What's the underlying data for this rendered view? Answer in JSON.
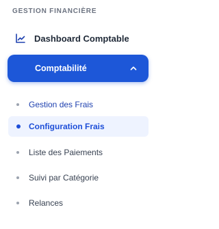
{
  "sidebar": {
    "section_title": "GESTION FINANCIÈRE",
    "dashboard": {
      "label": "Dashboard Comptable",
      "icon": "chart-line-icon"
    },
    "comptabilite": {
      "label": "Comptabilité",
      "expanded": true,
      "icon": "chevron-up-icon",
      "accent_color": "#1d57d8"
    },
    "sub_items": [
      {
        "label": "Gestion des Frais"
      },
      {
        "label": "Configuration Frais",
        "active": true
      },
      {
        "label": "Liste des Paiements"
      },
      {
        "label": "Suivi par Catégorie"
      },
      {
        "label": "Relances"
      }
    ]
  }
}
